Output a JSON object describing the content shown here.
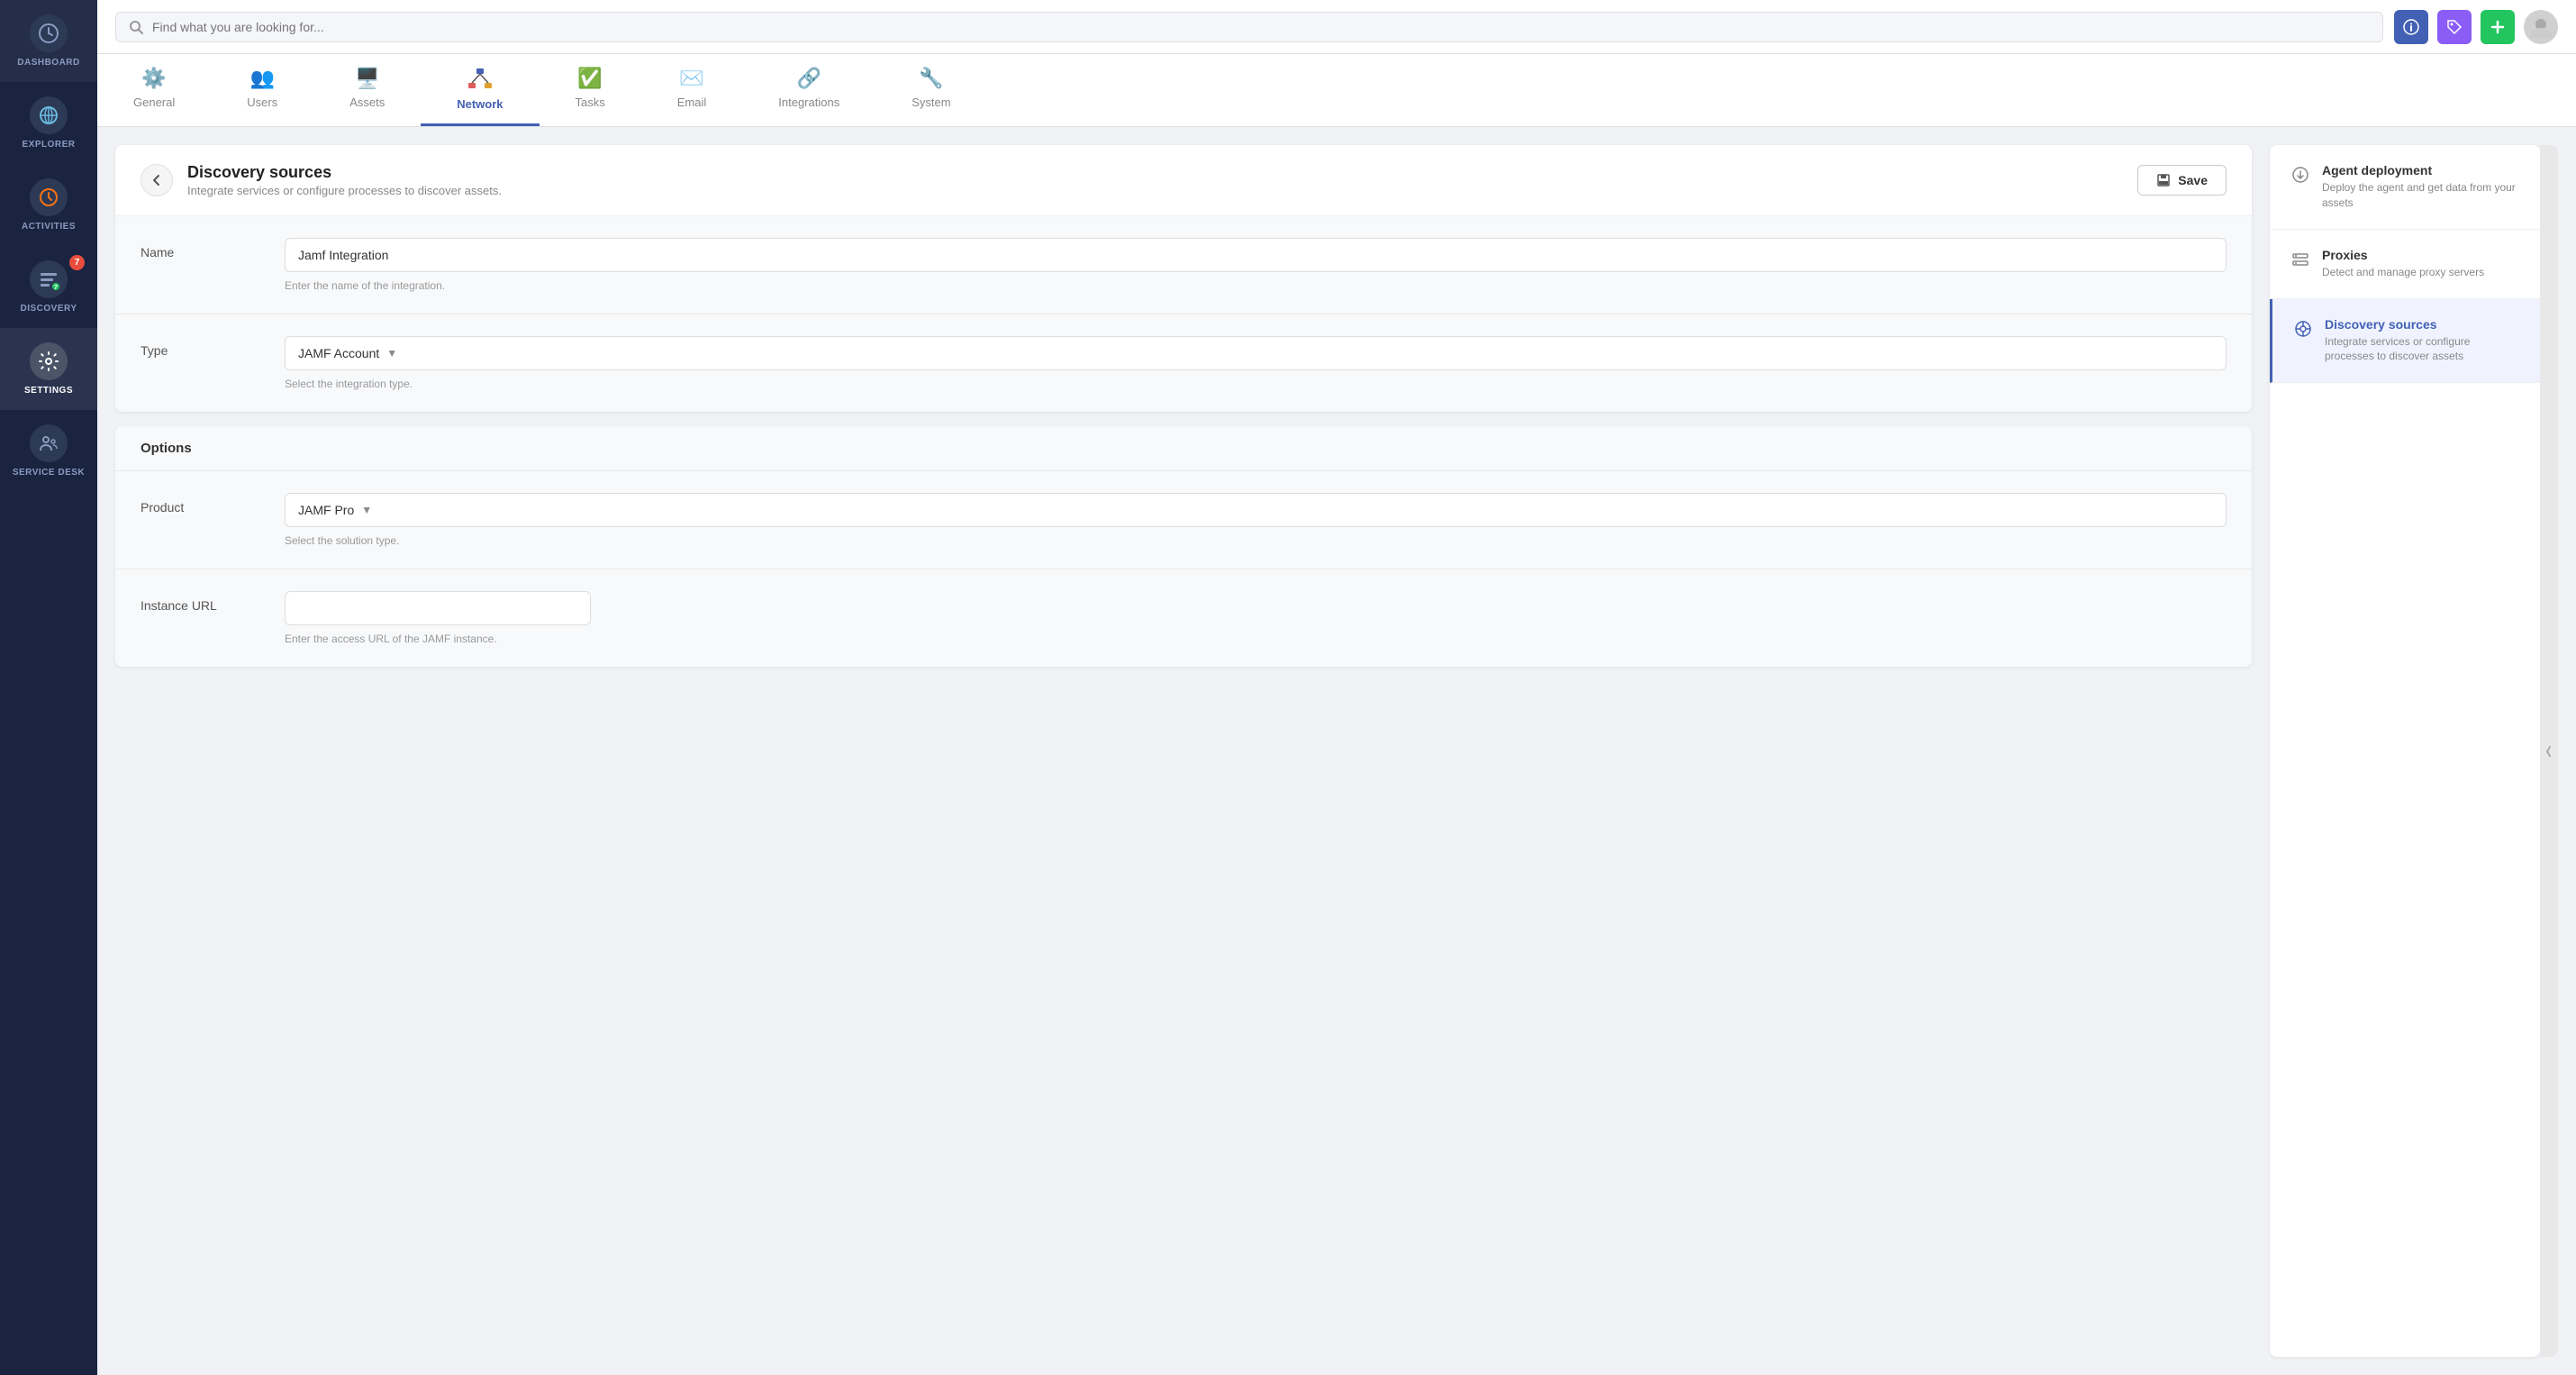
{
  "sidebar": {
    "items": [
      {
        "id": "dashboard",
        "label": "DASHBOARD",
        "icon": "📊",
        "active": false
      },
      {
        "id": "explorer",
        "label": "EXPLORER",
        "icon": "🌐",
        "active": false
      },
      {
        "id": "activities",
        "label": "ACTIVITIES",
        "icon": "⏱",
        "active": false,
        "badge": null
      },
      {
        "id": "discovery",
        "label": "DISCOVERY",
        "icon": "📋",
        "active": false,
        "badge": "7"
      },
      {
        "id": "settings",
        "label": "SETTINGS",
        "icon": "⚙",
        "active": true
      },
      {
        "id": "service-desk",
        "label": "SERVICE DESK",
        "icon": "👥",
        "active": false
      }
    ]
  },
  "topbar": {
    "search_placeholder": "Find what you are looking for...",
    "search_value": ""
  },
  "nav_tabs": [
    {
      "id": "general",
      "label": "General",
      "active": false
    },
    {
      "id": "users",
      "label": "Users",
      "active": false
    },
    {
      "id": "assets",
      "label": "Assets",
      "active": false
    },
    {
      "id": "network",
      "label": "Network",
      "active": true
    },
    {
      "id": "tasks",
      "label": "Tasks",
      "active": false
    },
    {
      "id": "email",
      "label": "Email",
      "active": false
    },
    {
      "id": "integrations",
      "label": "Integrations",
      "active": false
    },
    {
      "id": "system",
      "label": "System",
      "active": false
    }
  ],
  "discovery_sources": {
    "title": "Discovery sources",
    "subtitle": "Integrate services or configure processes to discover assets.",
    "save_label": "Save",
    "form": {
      "name_label": "Name",
      "name_value": "Jamf Integration",
      "name_placeholder": "",
      "name_hint": "Enter the name of the integration.",
      "type_label": "Type",
      "type_value": "JAMF Account",
      "type_hint": "Select the integration type.",
      "options_header": "Options",
      "product_label": "Product",
      "product_value": "JAMF Pro",
      "product_hint": "Select the solution type.",
      "instance_url_label": "Instance URL",
      "instance_url_value": "",
      "instance_url_hint": "Enter the access URL of the JAMF instance."
    }
  },
  "right_sidebar": {
    "items": [
      {
        "id": "agent-deployment",
        "title": "Agent deployment",
        "description": "Deploy the agent and get data from your assets",
        "active": false
      },
      {
        "id": "proxies",
        "title": "Proxies",
        "description": "Detect and manage proxy servers",
        "active": false
      },
      {
        "id": "discovery-sources",
        "title": "Discovery sources",
        "description": "Integrate services or configure processes to discover assets",
        "active": true
      }
    ]
  }
}
